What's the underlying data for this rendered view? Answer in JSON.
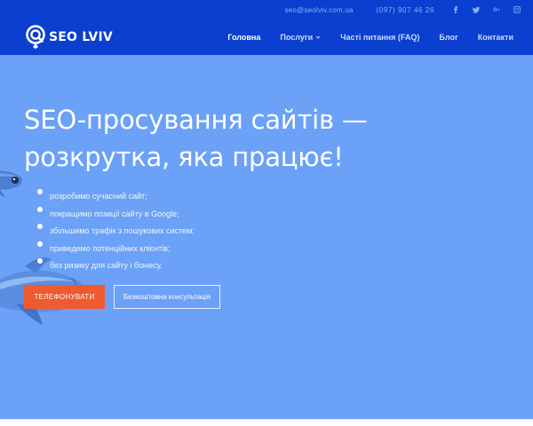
{
  "topbar": {
    "email": "seo@seolviv.com.ua",
    "phone": "(097) 907 46 26",
    "social": [
      "facebook-icon",
      "twitter-icon",
      "google-plus-icon",
      "instagram-icon"
    ]
  },
  "brand": {
    "name": "SEO LVIV"
  },
  "nav": {
    "items": [
      {
        "label": "Головна",
        "active": true
      },
      {
        "label": "Послуги",
        "dropdown": true
      },
      {
        "label": "Часті питання (FAQ)"
      },
      {
        "label": "Блог"
      },
      {
        "label": "Контакти"
      }
    ]
  },
  "hero": {
    "title_line1": "SEO-просування сайтів —",
    "title_line2": "розкрутка, яка працює!",
    "bullets": [
      "розробимо сучасний сайт;",
      "покращимо позиції сайту в Google;",
      "збільшимо трафік з пошукових систем;",
      "приведемо потенційних клієнтів;",
      "без ризику для сайту і бізнесу."
    ],
    "primary_button": "ТЕЛЕФОНУВАТИ",
    "secondary_button": "Безкоштовна консультація"
  },
  "colors": {
    "header": "#0a3fcf",
    "hero": "#6ba1f7",
    "accent": "#ef5a2f"
  }
}
